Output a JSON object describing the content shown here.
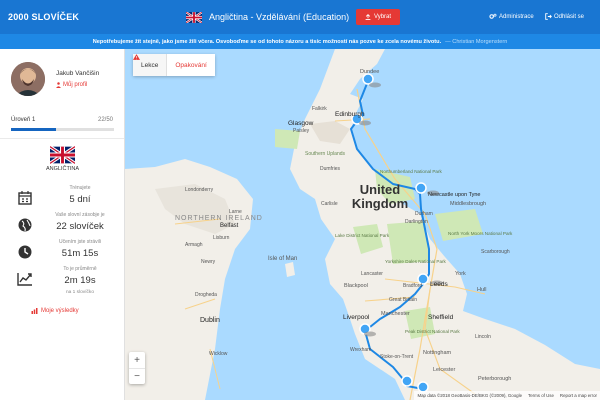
{
  "header": {
    "brand": "2000 SLOVÍČEK",
    "course": "Angličtina - Vzdělávání (Education)",
    "select_label": "Vybrat",
    "admin_label": "Administrace",
    "logout_label": "Odhlásit se"
  },
  "quote": {
    "text": "Nepotřebujeme žít stejně, jako jsme žili včera. Osvoboďme se od tohoto názoru a tisíc možností nás pozve ke zcela novému životu.",
    "author": "— Christian Morgenstern"
  },
  "user": {
    "name": "Jakub Vančišin",
    "profile_label": "Můj profil",
    "level_label": "Úroveň 1",
    "level_count": "22/50",
    "progress": 0.44,
    "language": "ANGLIČTINA"
  },
  "stats": [
    {
      "icon": "calendar-icon",
      "label": "Trénujete",
      "value": "5 dní",
      "sub": ""
    },
    {
      "icon": "globe-icon",
      "label": "Vaše slovní zásobje je",
      "value": "22 slovíček",
      "sub": ""
    },
    {
      "icon": "clock-icon",
      "label": "Učením jste strávili",
      "value": "51m 15s",
      "sub": ""
    },
    {
      "icon": "trend-icon",
      "label": "To je průměrně",
      "value": "2m 19s",
      "sub": "na 1 slovíčko"
    }
  ],
  "results_label": "Moje výsledky",
  "map": {
    "tabs": [
      "Lekce",
      "Opakování"
    ],
    "labels": {
      "uk": "United Kingdom",
      "ni": "NORTHERN IRELAND",
      "isle": "Isle of Man",
      "edinburgh": "Edinburgh",
      "glasgow": "Glasgow",
      "newcastle": "Newcastle upon Tyne",
      "leeds": "Leeds",
      "liverpool": "Liverpool",
      "sheffield": "Sheffield",
      "dublin": "Dublin",
      "belfast": "Belfast",
      "york": "York",
      "manchester": "Manchester",
      "blackpool": "Blackpool",
      "nottingham": "Nottingham",
      "leicester": "Leicester",
      "peterborough": "Peterborough",
      "middlesbrough": "Middlesbrough",
      "durham": "Durham",
      "dundee": "Dundee",
      "paisley": "Paisley",
      "hull": "Hull",
      "carlisle": "Carlisle",
      "derry": "Londonderry",
      "lisburn": "Lisburn",
      "newry": "Newry",
      "drogheda": "Drogheda",
      "wexford": "Wicklow",
      "northumberland": "Northumberland National Park",
      "lakedistrict": "Lake District National Park",
      "yorkdales": "Yorkshire Dales National Park",
      "yorkmoors": "North York Moors National Park",
      "peak": "Peak District National Park",
      "southern": "Southern Uplands",
      "bradford": "Bradford",
      "stokeontrent": "Stoke-on-Trent",
      "darlington": "Darlington",
      "lancaster": "Lancaster",
      "scarborough": "Scarborough",
      "dumfries": "Dumfries",
      "falkirk": "Falkirk",
      "larne": "Larne",
      "armagh": "Armagh",
      "lincoln": "Lincoln",
      "wrexham": "Wrexham",
      "greatbritain": "Great Britain"
    },
    "attribution": [
      "Map data ©2018 GeoBasis-DE/BKG (©2009), Google",
      "Terms of Use",
      "Report a map error"
    ],
    "zoom_in": "+",
    "zoom_out": "−",
    "colors": {
      "water": "#aadaff",
      "land": "#f2efe9",
      "park": "#cfe8b6",
      "route": "#1e88e5",
      "marker": "#42a5f5"
    }
  }
}
